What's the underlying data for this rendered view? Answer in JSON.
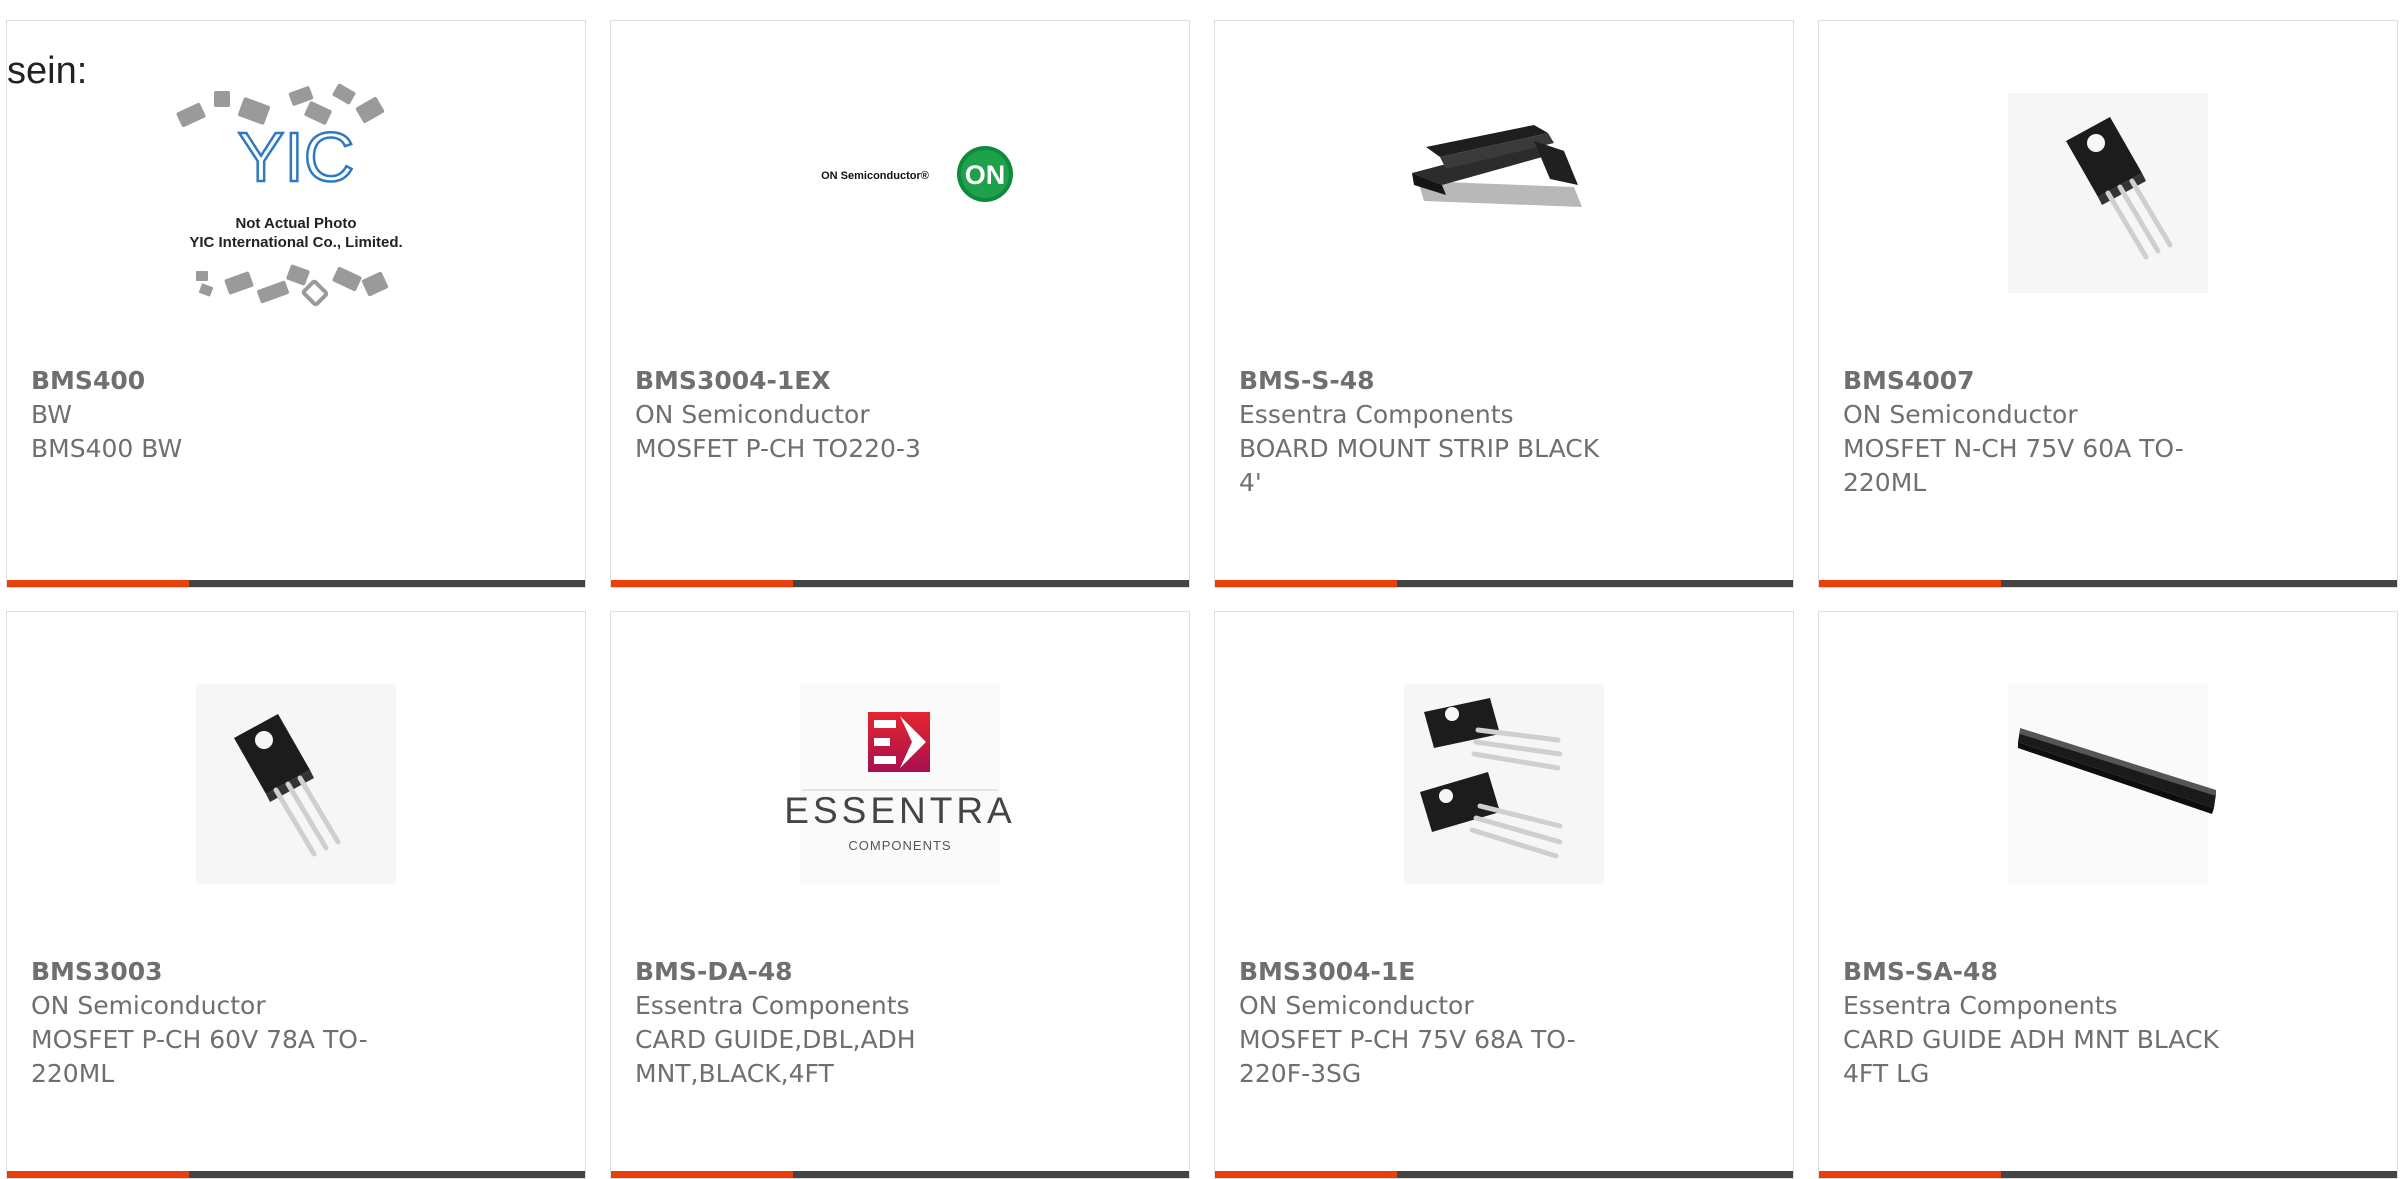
{
  "page": {
    "lead_text": "sein:"
  },
  "colors": {
    "accent": "#e8400c",
    "bar": "#444444",
    "card_border": "#dedede",
    "text": "#6f6f6f"
  },
  "products": [
    {
      "part": "BMS400",
      "maker": "BW",
      "desc": "BMS400 BW",
      "image": "yic-placeholder-photo",
      "image_text": {
        "logo": "YIC",
        "line1": "Not Actual Photo",
        "line2": "YIC International Co., Limited."
      }
    },
    {
      "part": "BMS3004-1EX",
      "maker": "ON Semiconductor",
      "desc": "MOSFET P-CH TO220-3",
      "image": "on-semiconductor-logo",
      "image_text": {
        "brand": "ON Semiconductor®",
        "badge": "ON"
      }
    },
    {
      "part": "BMS-S-48",
      "maker": "Essentra Components",
      "desc": "BOARD MOUNT STRIP BLACK 4'",
      "image": "black-mount-strip-photo"
    },
    {
      "part": "BMS4007",
      "maker": "ON Semiconductor",
      "desc": "MOSFET N-CH 75V 60A TO-220ML",
      "image": "to220-transistor-photo"
    },
    {
      "part": "BMS3003",
      "maker": "ON Semiconductor",
      "desc": "MOSFET P-CH 60V 78A TO-220ML",
      "image": "to220-transistor-photo"
    },
    {
      "part": "BMS-DA-48",
      "maker": "Essentra Components",
      "desc": "CARD GUIDE,DBL,ADH MNT,BLACK,4FT",
      "image": "essentra-logo",
      "image_text": {
        "brand": "ESSENTRA",
        "sub": "COMPONENTS"
      }
    },
    {
      "part": "BMS3004-1E",
      "maker": "ON Semiconductor",
      "desc": "MOSFET P-CH 75V 68A TO-220F-3SG",
      "image": "two-transistors-photo"
    },
    {
      "part": "BMS-SA-48",
      "maker": "Essentra Components",
      "desc": "CARD GUIDE ADH MNT BLACK 4FT LG",
      "image": "black-card-guide-photo"
    }
  ]
}
